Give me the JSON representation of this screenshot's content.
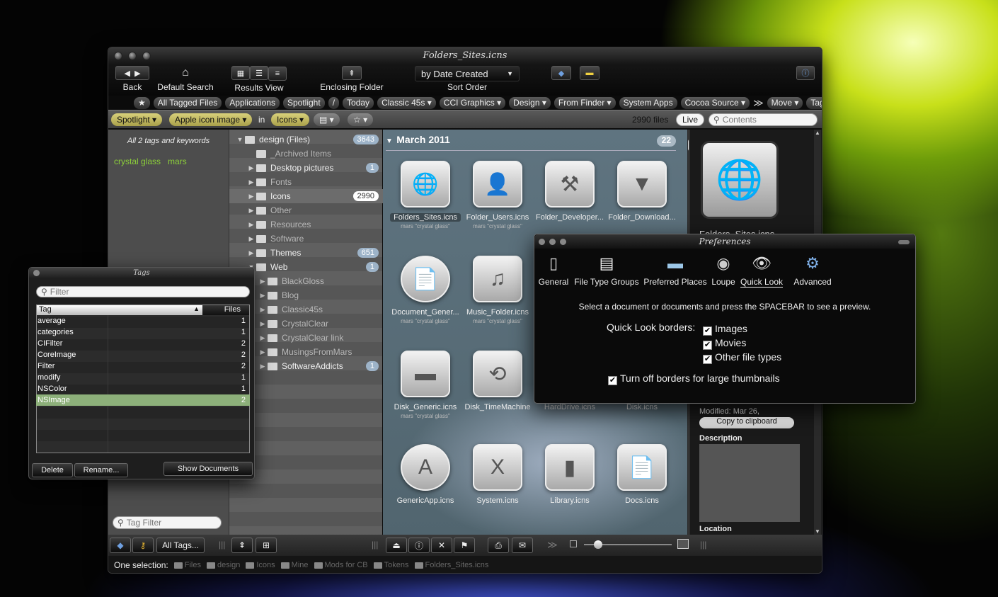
{
  "window": {
    "title": "Folders_Sites.icns"
  },
  "toolbar": {
    "back_label": "Back",
    "default_search_label": "Default Search",
    "results_view_label": "Results View",
    "enclosing_folder_label": "Enclosing Folder",
    "sort_value": "by Date Created",
    "sort_label": "Sort Order"
  },
  "tag_bar": {
    "items": [
      "All Tagged Files",
      "Applications",
      "Spotlight",
      "/",
      "Today",
      "Classic 45s ▾",
      "CCI Graphics ▾",
      "Design ▾",
      "From Finder ▾",
      "System Apps",
      "Cocoa Source ▾",
      "Move ▾",
      "Tag ▾"
    ],
    "overflow": "≫"
  },
  "search_bar": {
    "scope1": "Spotlight ▾",
    "scope2": "Apple icon image ▾",
    "in_label": "in",
    "scope3": "Icons ▾",
    "file_count": "2990 files",
    "live_label": "Live",
    "contents_placeholder": "Contents"
  },
  "left_pane": {
    "header": "All 2 tags and keywords",
    "tags": [
      "crystal glass",
      "mars"
    ],
    "tag_filter_placeholder": "Tag Filter"
  },
  "tree": [
    {
      "label": "design (Files)",
      "badge": "3643",
      "indent": 0,
      "arrow": "▼",
      "dim": false
    },
    {
      "label": "_Archived Items",
      "badge": "",
      "indent": 1,
      "arrow": "",
      "dim": true
    },
    {
      "label": "Desktop pictures",
      "badge": "1",
      "indent": 1,
      "arrow": "▶",
      "dim": false
    },
    {
      "label": "Fonts",
      "badge": "",
      "indent": 1,
      "arrow": "▶",
      "dim": true
    },
    {
      "label": "Icons",
      "badge": "2990",
      "indent": 1,
      "arrow": "▶",
      "dim": false
    },
    {
      "label": "Other",
      "badge": "",
      "indent": 1,
      "arrow": "▶",
      "dim": true
    },
    {
      "label": "Resources",
      "badge": "",
      "indent": 1,
      "arrow": "▶",
      "dim": true
    },
    {
      "label": "Software",
      "badge": "",
      "indent": 1,
      "arrow": "▶",
      "dim": true
    },
    {
      "label": "Themes",
      "badge": "651",
      "indent": 1,
      "arrow": "▶",
      "dim": false
    },
    {
      "label": "Web",
      "badge": "1",
      "indent": 1,
      "arrow": "▼",
      "dim": false
    },
    {
      "label": "BlackGloss",
      "badge": "",
      "indent": 2,
      "arrow": "▶",
      "dim": true
    },
    {
      "label": "Blog",
      "badge": "",
      "indent": 2,
      "arrow": "▶",
      "dim": true
    },
    {
      "label": "Classic45s",
      "badge": "",
      "indent": 2,
      "arrow": "▶",
      "dim": true
    },
    {
      "label": "CrystalClear",
      "badge": "",
      "indent": 2,
      "arrow": "▶",
      "dim": true
    },
    {
      "label": "CrystalClear link",
      "badge": "",
      "indent": 2,
      "arrow": "▶",
      "dim": true
    },
    {
      "label": "MusingsFromMars",
      "badge": "",
      "indent": 2,
      "arrow": "▶",
      "dim": true
    },
    {
      "label": "SoftwareAddicts",
      "badge": "1",
      "indent": 2,
      "arrow": "▶",
      "dim": false
    }
  ],
  "results": {
    "group_title": "March 2011",
    "group_count": "22",
    "items": [
      {
        "name": "Folders_Sites.icns",
        "sub": "mars \"crystal glass\"",
        "glyph": "🌐",
        "shape": "sq"
      },
      {
        "name": "Folder_Users.icns",
        "sub": "mars \"crystal glass\"",
        "glyph": "👤",
        "shape": "sq"
      },
      {
        "name": "Folder_Developer...",
        "sub": "",
        "glyph": "⚒",
        "shape": "sq"
      },
      {
        "name": "Folder_Download...",
        "sub": "",
        "glyph": "▼",
        "shape": "sq"
      },
      {
        "name": "Document_Gener...",
        "sub": "mars \"crystal glass\"",
        "glyph": "📄",
        "shape": "round"
      },
      {
        "name": "Music_Folder.icns",
        "sub": "mars \"crystal glass\"",
        "glyph": "♫",
        "shape": "sq"
      },
      {
        "name": "Disk_Generic.icns",
        "sub": "mars \"crystal glass\"",
        "glyph": "▬",
        "shape": "sq"
      },
      {
        "name": "Disk_TimeMachine",
        "sub": "",
        "glyph": "⟲",
        "shape": "sq"
      },
      {
        "name": "HardDrive.icns",
        "sub": "",
        "glyph": "",
        "shape": "none"
      },
      {
        "name": "Disk.icns",
        "sub": "",
        "glyph": "",
        "shape": "none"
      },
      {
        "name": "GenericApp.icns",
        "sub": "",
        "glyph": "A",
        "shape": "round"
      },
      {
        "name": "System.icns",
        "sub": "",
        "glyph": "X",
        "shape": "sq"
      },
      {
        "name": "Library.icns",
        "sub": "",
        "glyph": "▮",
        "shape": "sq"
      },
      {
        "name": "Docs.icns",
        "sub": "",
        "glyph": "📄",
        "shape": "sq"
      }
    ]
  },
  "info_pane": {
    "title_partial": "Folders_Sites.icns",
    "modified": "Modified: Mar 26,",
    "copy_button": "Copy to clipboard",
    "description_label": "Description",
    "location_label": "Location"
  },
  "bottom_bar": {
    "all_tags_button": "All Tags..."
  },
  "status_bar": {
    "label": "One selection:",
    "path": [
      "Files",
      "design",
      "Icons",
      "Mine",
      "Mods for CB",
      "Tokens",
      "Folders_Sites.icns"
    ]
  },
  "tags_panel": {
    "title": "Tags",
    "filter_placeholder": "Filter",
    "col_tag": "Tag",
    "col_files": "Files",
    "rows": [
      {
        "tag": "average",
        "count": "1"
      },
      {
        "tag": "categories",
        "count": "1"
      },
      {
        "tag": "CIFilter",
        "count": "2"
      },
      {
        "tag": "CoreImage",
        "count": "2"
      },
      {
        "tag": "Filter",
        "count": "2"
      },
      {
        "tag": "modify",
        "count": "1"
      },
      {
        "tag": "NSColor",
        "count": "1"
      },
      {
        "tag": "NSImage",
        "count": "2"
      }
    ],
    "selected_index": 7,
    "delete_button": "Delete",
    "rename_button": "Rename...",
    "show_documents_button": "Show Documents"
  },
  "prefs": {
    "title": "Preferences",
    "tabs": [
      {
        "label": "General",
        "glyph": "▯"
      },
      {
        "label": "File Type Groups",
        "glyph": "▤"
      },
      {
        "label": "Preferred Places",
        "glyph": "▬"
      },
      {
        "label": "Loupe",
        "glyph": "◉"
      },
      {
        "label": "Quick Look",
        "glyph": "👁"
      },
      {
        "label": "Advanced",
        "glyph": "⚙"
      }
    ],
    "selected_tab": 4,
    "instruction": "Select a document or documents and press the SPACEBAR to see a preview.",
    "borders_label": "Quick Look borders:",
    "opt_images": "Images",
    "opt_movies": "Movies",
    "opt_other": "Other file types",
    "opt_large": "Turn off borders for large thumbnails"
  },
  "colors": {
    "accent_yellow": "#cfc66e",
    "badge": "#9db3c8",
    "selection_green": "#8db07a",
    "tag_text_green": "#8ccf3a"
  }
}
